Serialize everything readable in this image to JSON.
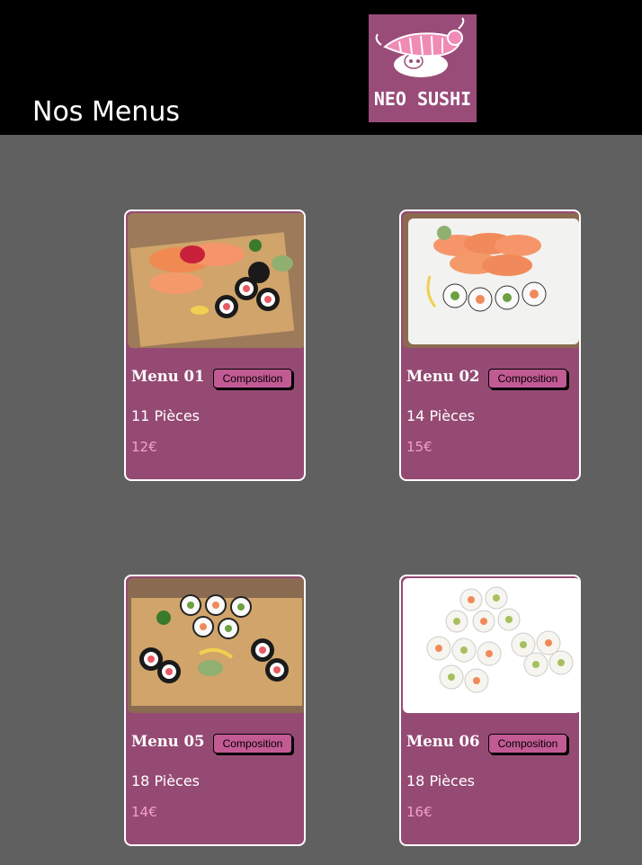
{
  "header": {
    "title": "Nos Menus",
    "logo_text": "NEO SUSHI"
  },
  "menus": [
    {
      "name": "Menu 01",
      "button": "Composition",
      "pieces": "11 Pièces",
      "price": "12€",
      "photo": "nigiri and maki platter on wooden board"
    },
    {
      "name": "Menu 02",
      "button": "Composition",
      "pieces": "14 Pièces",
      "price": "15€",
      "photo": "salmon nigiri and california rolls on white plate"
    },
    {
      "name": "Menu 05",
      "button": "Composition",
      "pieces": "18 Pièces",
      "price": "14€",
      "photo": "assorted maki rolls on wooden board"
    },
    {
      "name": "Menu 06",
      "button": "Composition",
      "pieces": "18 Pièces",
      "price": "16€",
      "photo": "california rolls with sesame on white background"
    }
  ],
  "colors": {
    "header_bg": "#000000",
    "page_bg": "#606060",
    "card_bg": "#954a73",
    "button_bg": "#c25a94",
    "price_text": "#f4a0c8",
    "logo_bg": "#9a4c79"
  }
}
